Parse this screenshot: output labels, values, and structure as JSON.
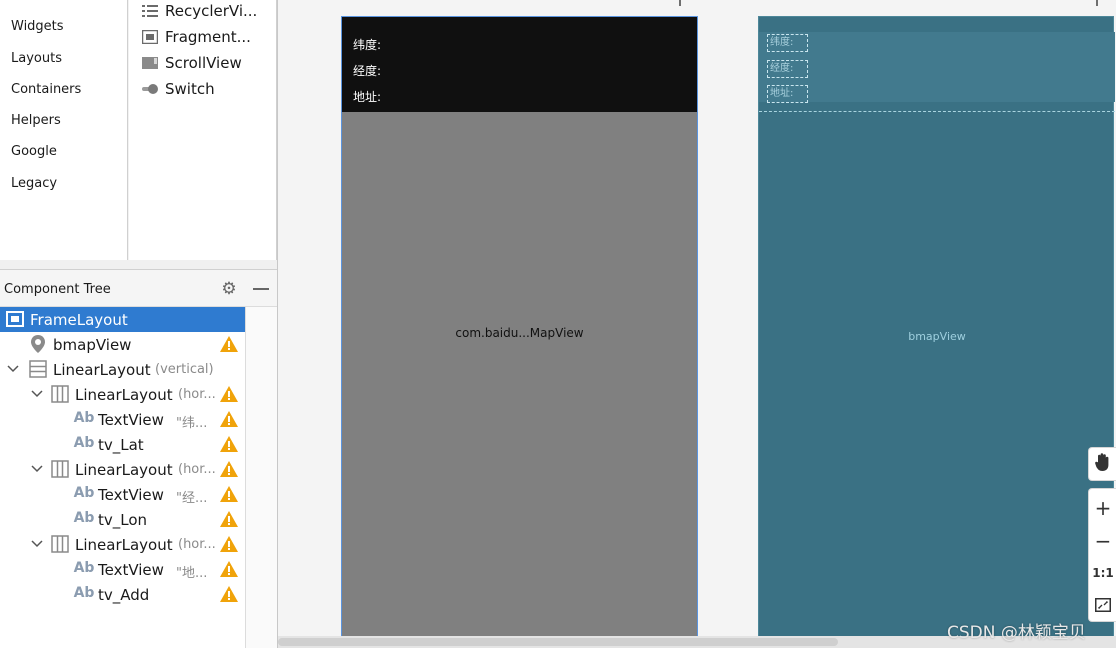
{
  "palette": {
    "categories": [
      "Widgets",
      "Layouts",
      "Containers",
      "Helpers",
      "Google",
      "Legacy"
    ],
    "items": [
      {
        "label": "RecyclerVi...",
        "icon": "list-icon"
      },
      {
        "label": "Fragment...",
        "icon": "fragment-icon"
      },
      {
        "label": "ScrollView",
        "icon": "scrollview-icon"
      },
      {
        "label": "Switch",
        "icon": "switch-icon"
      }
    ]
  },
  "component_tree": {
    "title": "Component Tree",
    "rows": [
      {
        "label": "FrameLayout",
        "hint": "",
        "icon": "frame-layout-icon",
        "selected": true,
        "warning": false
      },
      {
        "label": "bmapView",
        "hint": "",
        "icon": "map-pin-icon",
        "selected": false,
        "warning": true
      },
      {
        "label": "LinearLayout",
        "hint": "(vertical)",
        "icon": "linear-vertical-icon",
        "selected": false,
        "warning": false
      },
      {
        "label": "LinearLayout",
        "hint": "(hor...",
        "icon": "linear-horizontal-icon",
        "selected": false,
        "warning": true
      },
      {
        "label": "TextView",
        "hint": "\"纬...",
        "icon": "textview-icon",
        "selected": false,
        "warning": true
      },
      {
        "label": "tv_Lat",
        "hint": "",
        "icon": "textview-icon",
        "selected": false,
        "warning": true
      },
      {
        "label": "LinearLayout",
        "hint": "(hor...",
        "icon": "linear-horizontal-icon",
        "selected": false,
        "warning": true
      },
      {
        "label": "TextView",
        "hint": "\"经...",
        "icon": "textview-icon",
        "selected": false,
        "warning": true
      },
      {
        "label": "tv_Lon",
        "hint": "",
        "icon": "textview-icon",
        "selected": false,
        "warning": true
      },
      {
        "label": "LinearLayout",
        "hint": "(hor...",
        "icon": "linear-horizontal-icon",
        "selected": false,
        "warning": true
      },
      {
        "label": "TextView",
        "hint": "\"地...",
        "icon": "textview-icon",
        "selected": false,
        "warning": true
      },
      {
        "label": "tv_Add",
        "hint": "",
        "icon": "textview-icon",
        "selected": false,
        "warning": true
      }
    ]
  },
  "design": {
    "labels": [
      "纬度:",
      "经度:",
      "地址:"
    ],
    "mapview": "com.baidu...MapView"
  },
  "blueprint": {
    "labels": [
      "纬度:",
      "经度:",
      "地址:"
    ],
    "mapview": "bmapView"
  },
  "zoom": {
    "fit_label": "1:1"
  },
  "watermark": "CSDN @林颖宝贝",
  "colors": {
    "selection": "#2f7bd0",
    "blueprint": "#3a7184",
    "warning": "#f0a30a"
  }
}
